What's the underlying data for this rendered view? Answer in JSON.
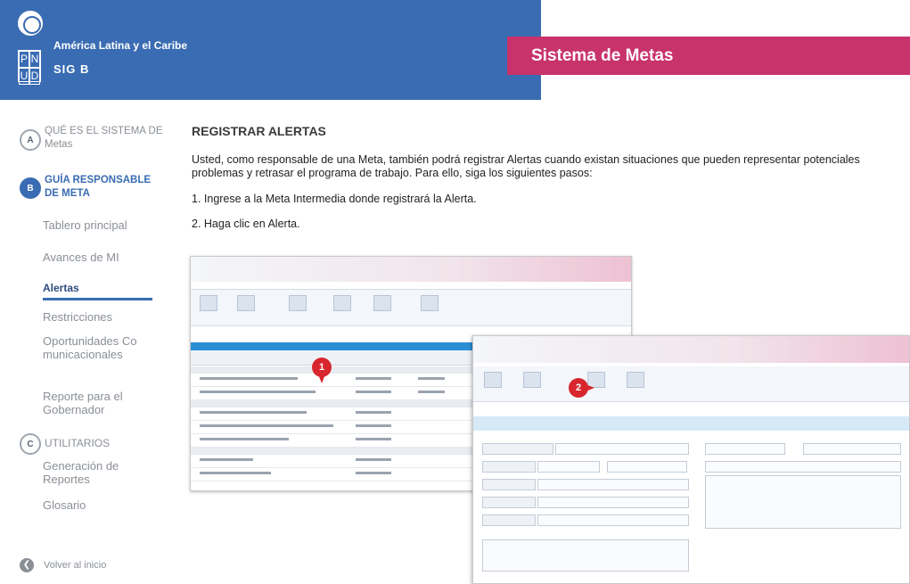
{
  "header": {
    "region": "América Latina y el Caribe",
    "pnud_letters": [
      "P",
      "N",
      "U",
      "D"
    ],
    "sigob": "SIG B",
    "system_title": "Sistema de Metas"
  },
  "sidebar": {
    "sections": [
      {
        "letter": "A",
        "label": "QUÉ ES EL SISTEMA DE Metas"
      },
      {
        "letter": "B",
        "label": "GUÍA RESPONSABLE DE META"
      },
      {
        "letter": "C",
        "label": "UTILITARIOS"
      }
    ],
    "items_b": [
      "Tablero principal",
      "Avances de MI",
      "Alertas",
      "Restricciones",
      "Oportunidades Comunicacionales",
      "Reporte para el Gobernador"
    ],
    "items_c": [
      "Generación de Reportes",
      "Glosario"
    ],
    "back_label": "Volver al inicio"
  },
  "main": {
    "title": "REGISTRAR ALERTAS",
    "intro": "Usted, como responsable de una Meta, también podrá registrar Alertas cuando existan situaciones que pueden representar potenciales problemas y retrasar el programa de trabajo. Para ello, siga los siguientes pasos:",
    "steps": [
      "1. Ingrese a la Meta Intermedia donde registrará la Alerta.",
      "2. Haga clic en Alerta."
    ]
  },
  "markers": [
    "1",
    "2"
  ],
  "colors": {
    "header_blue": "#3a6cb3",
    "header_pink": "#c8336b",
    "marker_red": "#d8262e"
  }
}
